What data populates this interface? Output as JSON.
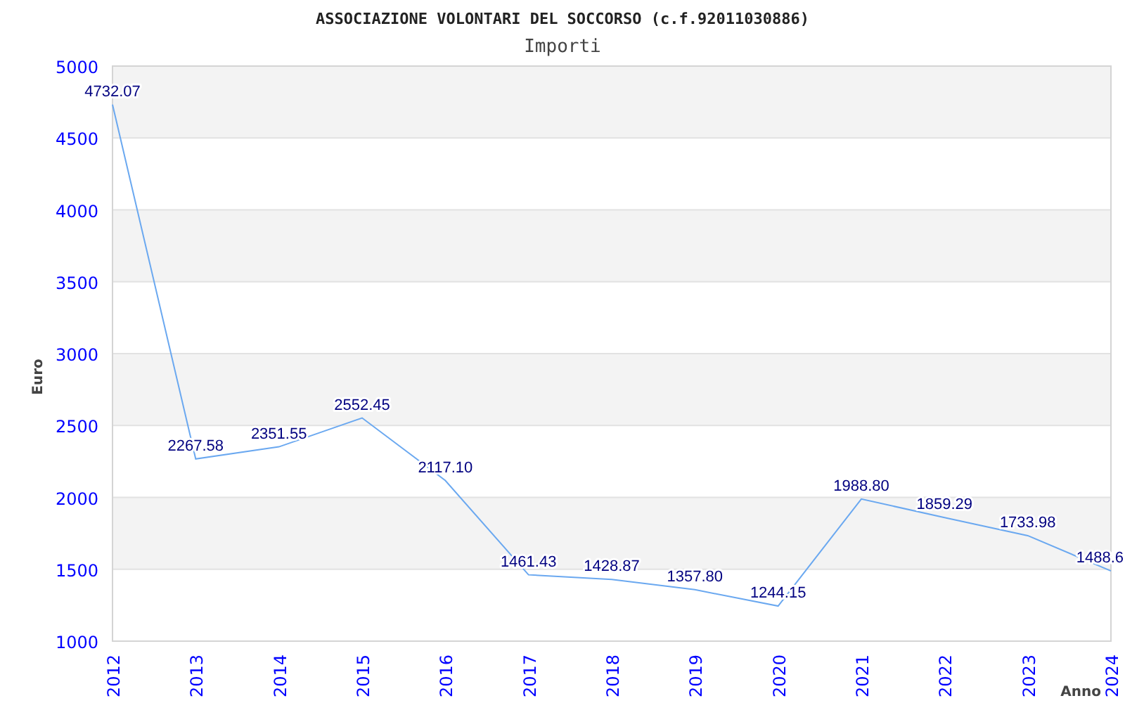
{
  "title": "ASSOCIAZIONE VOLONTARI DEL SOCCORSO (c.f.92011030886)",
  "chart_data": {
    "type": "line",
    "title": "Importi",
    "xlabel": "Anno",
    "ylabel": "Euro",
    "categories": [
      "2012",
      "2013",
      "2014",
      "2015",
      "2016",
      "2017",
      "2018",
      "2019",
      "2020",
      "2021",
      "2022",
      "2023",
      "2024"
    ],
    "grid": true,
    "series": [
      {
        "color": "#6aa8f0",
        "values": [
          4732.07,
          2267.58,
          2351.55,
          2552.45,
          2117.1,
          1461.43,
          1428.87,
          1357.8,
          1244.15,
          1988.8,
          1859.29,
          1733.98,
          1488.6
        ]
      }
    ],
    "ylim": [
      1000,
      5000
    ],
    "yticks": [
      1000,
      1500,
      2000,
      2500,
      3000,
      3500,
      4000,
      4500,
      5000
    ],
    "value_labels": [
      "4732.07",
      "2267.58",
      "2351.55",
      "2552.45",
      "2117.10",
      "1461.43",
      "1428.87",
      "1357.80",
      "1244.15",
      "1988.80",
      "1859.29",
      "1733.98",
      "1488.6"
    ]
  }
}
